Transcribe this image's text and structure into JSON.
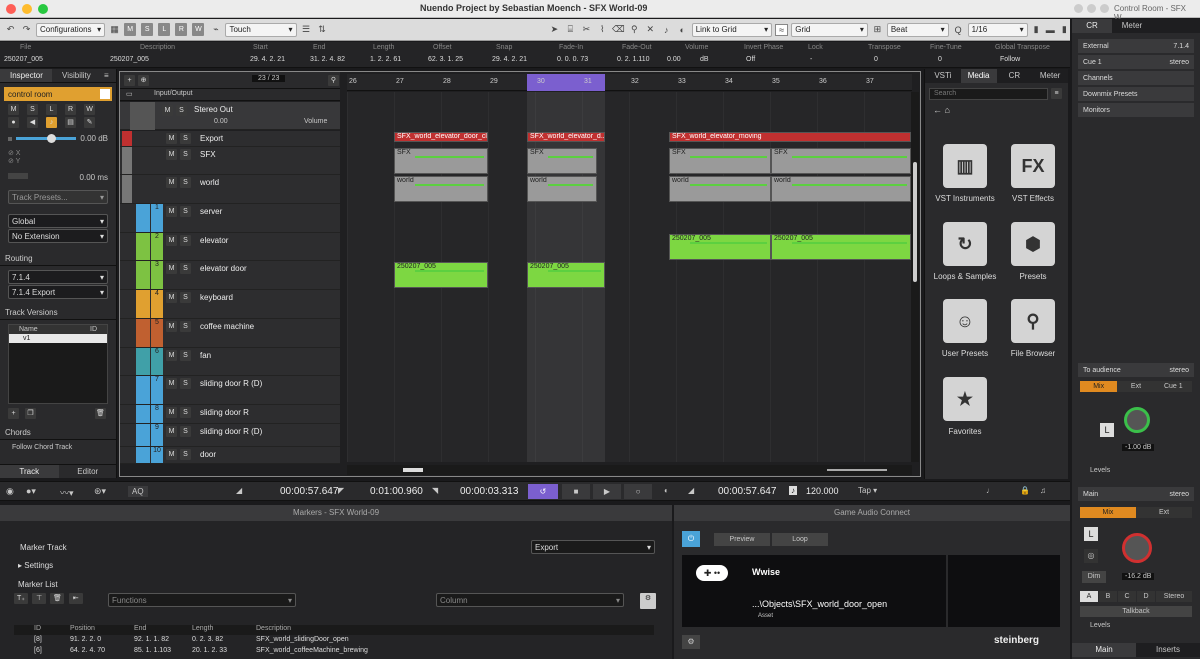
{
  "window": {
    "title": "Nuendo Project by Sebastian Moench - SFX World-09",
    "cr_title": "Control Room - SFX W..."
  },
  "toolbar": {
    "configurations": "Configurations",
    "m": "M",
    "s": "S",
    "l": "L",
    "r": "R",
    "w": "W",
    "automation_mode": "Touch",
    "link": "Link to Grid",
    "grid": "Grid",
    "beat": "Beat",
    "quantize": "1/16"
  },
  "infoline": {
    "headers": [
      "File",
      "Description",
      "Start",
      "End",
      "Length",
      "Offset",
      "Snap",
      "Fade-In",
      "Fade-Out",
      "Volume",
      "Invert Phase",
      "Lock",
      "Transpose",
      "Fine-Tune",
      "Global Transpose"
    ],
    "values": [
      "250207_005",
      "250207_005",
      "29. 4. 2. 21",
      "31. 2. 4. 82",
      "1. 2. 2. 61",
      "62. 3. 1. 25",
      "29. 4. 2. 21",
      "0. 0. 0. 73",
      "0. 2. 1.110",
      "0.00",
      "dB",
      "Off",
      "-",
      "0",
      "0",
      "Follow"
    ]
  },
  "inspector": {
    "tab_inspector": "Inspector",
    "tab_visibility": "Visibility",
    "track": "control room",
    "volume": "0.00 dB",
    "time": "0.00 ms",
    "track_presets": "Track Presets...",
    "global": "Global",
    "no_extension": "No Extension",
    "routing": "Routing",
    "route1": "7.1.4",
    "route2": "7.1.4 Export",
    "track_versions": "Track Versions",
    "col_name": "Name",
    "col_id": "ID",
    "version": "v1",
    "chords": "Chords",
    "follow_chord": "Follow Chord Track",
    "tab_track": "Track",
    "tab_editor": "Editor"
  },
  "tracklist": {
    "counter": "23 / 23",
    "io": "Input/Output",
    "stereo_out": "Stereo Out",
    "stereo_vol": "0.00",
    "volume": "Volume",
    "tracks": [
      {
        "n": "",
        "name": "Export",
        "color": "#c03030"
      },
      {
        "n": "",
        "name": "SFX",
        "color": "#777"
      },
      {
        "n": "",
        "name": "world",
        "color": "#777"
      },
      {
        "n": "1",
        "name": "server",
        "color": "#4aa3d8"
      },
      {
        "n": "2",
        "name": "elevator",
        "color": "#7dc242"
      },
      {
        "n": "3",
        "name": "elevator door",
        "color": "#7dc242"
      },
      {
        "n": "4",
        "name": "keyboard",
        "color": "#e0a030"
      },
      {
        "n": "5",
        "name": "coffee machine",
        "color": "#c06030"
      },
      {
        "n": "6",
        "name": "fan",
        "color": "#40a0a8"
      },
      {
        "n": "7",
        "name": "sliding door R (D)",
        "color": "#4aa3d8"
      },
      {
        "n": "8",
        "name": "sliding door R",
        "color": "#4aa3d8"
      },
      {
        "n": "9",
        "name": "sliding door R (D)",
        "color": "#4aa3d8"
      },
      {
        "n": "10",
        "name": "door",
        "color": "#4aa3d8"
      }
    ]
  },
  "ruler": [
    "26",
    "27",
    "28",
    "29",
    "30",
    "31",
    "32",
    "33",
    "34",
    "35",
    "36",
    "37"
  ],
  "clips": {
    "export1": "SFX_world_elevator_door_close",
    "export2": "SFX_world_elevator_d...en",
    "export3": "SFX_world_elevator_moving",
    "sfx": "SFX",
    "world": "world",
    "audio": "250207_005"
  },
  "media": {
    "tabs": [
      "VSTi",
      "Media",
      "CR",
      "Meter"
    ],
    "search": "Search",
    "tiles": [
      "VST Instruments",
      "VST Effects",
      "Loops & Samples",
      "Presets",
      "User Presets",
      "File Browser",
      "Favorites"
    ]
  },
  "transport": {
    "pos1": "00:00:57.647",
    "pos2": "0:01:00.960",
    "pos3": "00:00:03.313",
    "pos4": "00:00:57.647",
    "tempo": "120.000",
    "tap": "Tap",
    "aq": "AQ"
  },
  "markers": {
    "title": "Markers - SFX World-09",
    "marker_track": "Marker Track",
    "export": "Export",
    "settings": "Settings",
    "marker_list": "Marker List",
    "functions": "Functions",
    "column": "Column",
    "headers": [
      "ID",
      "Position",
      "End",
      "Length",
      "Description"
    ],
    "rows": [
      {
        "id": "[8]",
        "pos": "91. 2. 2. 0",
        "end": "92. 1. 1. 82",
        "len": "0. 2. 3. 82",
        "desc": "SFX_world_slidingDoor_open"
      },
      {
        "id": "[6]",
        "pos": "64. 2. 4. 70",
        "end": "85. 1. 1.103",
        "len": "20. 1. 2. 33",
        "desc": "SFX_world_coffeeMachine_brewing"
      }
    ]
  },
  "gac": {
    "title": "Game Audio Connect",
    "preview": "Preview",
    "loop": "Loop",
    "wwise": "Wwise",
    "path": "...\\Objects\\SFX_world_door_open",
    "asset": "Asset",
    "brand": "steinberg"
  },
  "cr": {
    "tabs": [
      "CR",
      "Meter"
    ],
    "external": "External",
    "ext_fmt": "7.1.4",
    "cue1": "Cue 1",
    "stereo": "stereo",
    "channels": "Channels",
    "downmix": "Downmix Presets",
    "monitors": "Monitors",
    "to_audience": "To audience",
    "mix": "Mix",
    "ext": "Ext",
    "cue": "Cue 1",
    "levels": "Levels",
    "vol1": "-1.00 dB",
    "main": "Main",
    "vol2": "-16.2 dB",
    "dim": "Dim",
    "abcd": [
      "A",
      "B",
      "C",
      "D",
      "Stereo"
    ],
    "talkback": "Talkback",
    "tab_main": "Main",
    "tab_inserts": "Inserts"
  }
}
